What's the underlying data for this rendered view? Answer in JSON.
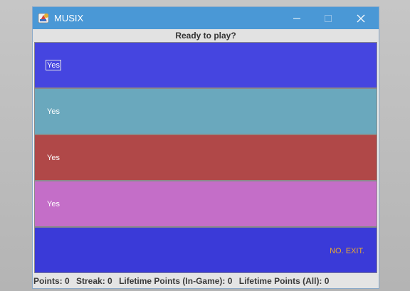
{
  "window": {
    "title": "MUSIX",
    "icon": "app-icon",
    "controls": [
      "minimize-icon",
      "maximize-icon",
      "close-icon"
    ]
  },
  "header": {
    "label": "Ready to play?"
  },
  "options": [
    {
      "label": "Yes",
      "color": "#4545e0",
      "focused": true
    },
    {
      "label": "Yes",
      "color": "#6aa8bd",
      "focused": false
    },
    {
      "label": "Yes",
      "color": "#b04848",
      "focused": false
    },
    {
      "label": "Yes",
      "color": "#c46ec8",
      "focused": false
    }
  ],
  "exit": {
    "label": "NO. EXIT.",
    "color": "#3a3ad8",
    "text_color": "#e8a832"
  },
  "status": {
    "points": "Points: 0",
    "streak": "Streak: 0",
    "lifetime_in_game": "Lifetime Points (In-Game): 0",
    "lifetime_all": "Lifetime Points (All): 0"
  },
  "colors": {
    "titlebar": "#4a98d6",
    "header_bg": "#e2e2e2",
    "status_bg": "#e4e4e4"
  }
}
